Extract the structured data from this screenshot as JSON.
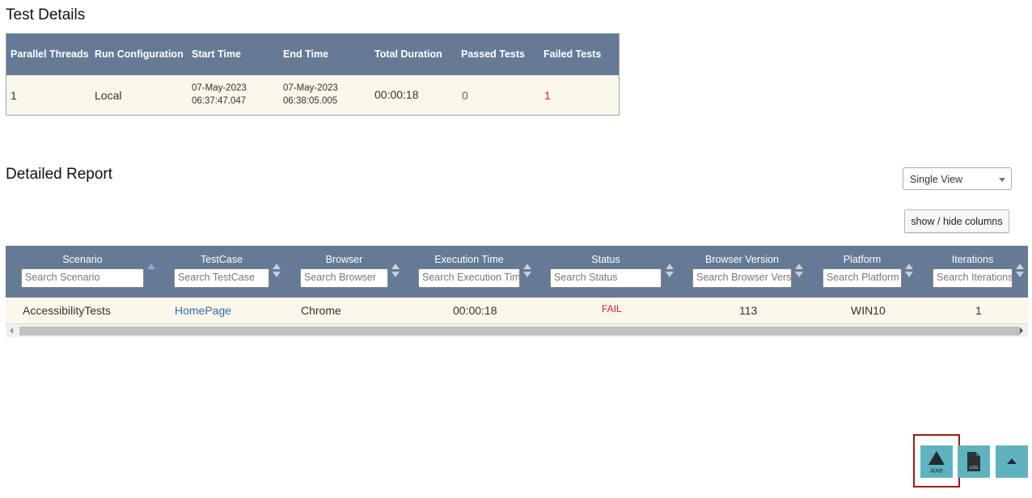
{
  "test_details": {
    "title": "Test Details",
    "headers": [
      "Parallel Threads",
      "Run Configuration",
      "Start Time",
      "End Time",
      "Total Duration",
      "Passed Tests",
      "Failed Tests"
    ],
    "row": {
      "parallel_threads": "1",
      "run_configuration": "Local",
      "start_date": "07-May-2023",
      "start_time": "06:37:47.047",
      "end_date": "07-May-2023",
      "end_time": "06:38:05.005",
      "total_duration": "00:00:18",
      "passed_tests": "0",
      "failed_tests": "1"
    },
    "colors": {
      "header_bg": "#657a95",
      "row_bg": "#fbf7ea",
      "passed": "#2e8b2e",
      "failed": "#d02020"
    }
  },
  "detailed_report": {
    "title": "Detailed Report",
    "view_select": {
      "selected": "Single View",
      "icon": "chevron-down-icon"
    },
    "columns_button": "show / hide columns",
    "columns": [
      {
        "label": "Scenario",
        "placeholder": "Search Scenario"
      },
      {
        "label": "TestCase",
        "placeholder": "Search TestCase"
      },
      {
        "label": "Browser",
        "placeholder": "Search Browser"
      },
      {
        "label": "Execution Time",
        "placeholder": "Search Execution Tim"
      },
      {
        "label": "Status",
        "placeholder": "Search Status"
      },
      {
        "label": "Browser Version",
        "placeholder": "Search Browser Vers"
      },
      {
        "label": "Platform",
        "placeholder": "Search Platform"
      },
      {
        "label": "Iterations",
        "placeholder": "Search Iterations"
      }
    ],
    "rows": [
      {
        "scenario": "AccessibilityTests",
        "testcase": "HomePage",
        "browser": "Chrome",
        "execution_time": "00:00:18",
        "status": "FAIL",
        "browser_version": "113",
        "platform": "WIN10",
        "iterations": "1"
      }
    ],
    "colors": {
      "link": "#2a6db5",
      "fail": "#d02020"
    }
  },
  "floating_buttons": {
    "axe": {
      "label": "axe",
      "icon": "axe-triangle-icon"
    },
    "log": {
      "label": "LOG",
      "icon": "log-file-icon"
    },
    "top": {
      "icon": "arrow-up-icon"
    }
  }
}
